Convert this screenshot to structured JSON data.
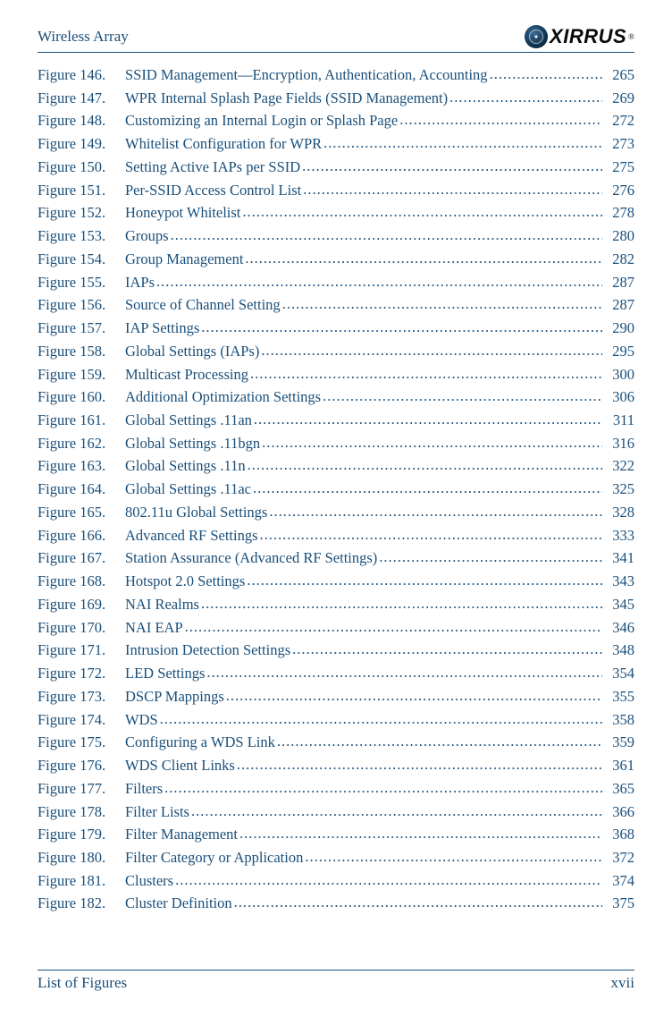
{
  "header": {
    "title": "Wireless Array",
    "logo_text": "XIRRUS"
  },
  "figures": [
    {
      "num": "Figure 146.",
      "title": "SSID Management—Encryption, Authentication, Accounting",
      "page": "265"
    },
    {
      "num": "Figure 147.",
      "title": "WPR Internal Splash Page Fields (SSID Management)",
      "page": "269"
    },
    {
      "num": "Figure 148.",
      "title": "Customizing an Internal Login or Splash Page ",
      "page": "272"
    },
    {
      "num": "Figure 149.",
      "title": "Whitelist Configuration for WPR",
      "page": "273"
    },
    {
      "num": "Figure 150.",
      "title": "Setting Active IAPs per SSID",
      "page": "275"
    },
    {
      "num": "Figure 151.",
      "title": "Per-SSID Access Control List",
      "page": "276"
    },
    {
      "num": "Figure 152.",
      "title": "Honeypot Whitelist ",
      "page": "278"
    },
    {
      "num": "Figure 153.",
      "title": "Groups",
      "page": "280"
    },
    {
      "num": "Figure 154.",
      "title": "Group Management ",
      "page": "282"
    },
    {
      "num": "Figure 155.",
      "title": "IAPs",
      "page": "287"
    },
    {
      "num": "Figure 156.",
      "title": "Source of Channel Setting ",
      "page": "287"
    },
    {
      "num": "Figure 157.",
      "title": "IAP Settings ",
      "page": "290"
    },
    {
      "num": "Figure 158.",
      "title": "Global Settings (IAPs) ",
      "page": "295"
    },
    {
      "num": "Figure 159.",
      "title": "Multicast Processing ",
      "page": "300"
    },
    {
      "num": "Figure 160.",
      "title": "Additional Optimization Settings ",
      "page": "306"
    },
    {
      "num": "Figure 161.",
      "title": "Global Settings .11an",
      "page": "311"
    },
    {
      "num": "Figure 162.",
      "title": "Global Settings .11bgn ",
      "page": "316"
    },
    {
      "num": "Figure 163.",
      "title": "Global Settings .11n",
      "page": "322"
    },
    {
      "num": "Figure 164.",
      "title": "Global Settings .11ac ",
      "page": "325"
    },
    {
      "num": "Figure 165.",
      "title": "802.11u Global Settings",
      "page": "328"
    },
    {
      "num": "Figure 166.",
      "title": "Advanced RF Settings",
      "page": "333"
    },
    {
      "num": "Figure 167.",
      "title": "Station Assurance (Advanced RF Settings) ",
      "page": "341"
    },
    {
      "num": "Figure 168.",
      "title": "Hotspot 2.0 Settings",
      "page": "343"
    },
    {
      "num": "Figure 169.",
      "title": "NAI Realms ",
      "page": "345"
    },
    {
      "num": "Figure 170.",
      "title": "NAI EAP ",
      "page": "346"
    },
    {
      "num": "Figure 171.",
      "title": "Intrusion Detection Settings",
      "page": "348"
    },
    {
      "num": "Figure 172.",
      "title": "LED Settings ",
      "page": "354"
    },
    {
      "num": "Figure 173.",
      "title": "DSCP Mappings",
      "page": "355"
    },
    {
      "num": "Figure 174.",
      "title": "WDS",
      "page": "358"
    },
    {
      "num": "Figure 175.",
      "title": "Configuring a WDS Link",
      "page": "359"
    },
    {
      "num": "Figure 176.",
      "title": "WDS Client Links ",
      "page": "361"
    },
    {
      "num": "Figure 177.",
      "title": "Filters ",
      "page": "365"
    },
    {
      "num": "Figure 178.",
      "title": "Filter Lists ",
      "page": "366"
    },
    {
      "num": "Figure 179.",
      "title": "Filter Management ",
      "page": "368"
    },
    {
      "num": "Figure 180.",
      "title": "Filter Category or Application",
      "page": "372"
    },
    {
      "num": "Figure 181.",
      "title": "Clusters ",
      "page": "374"
    },
    {
      "num": "Figure 182.",
      "title": "Cluster Definition",
      "page": "375"
    }
  ],
  "footer": {
    "section": "List of Figures",
    "page_num": "xvii"
  }
}
